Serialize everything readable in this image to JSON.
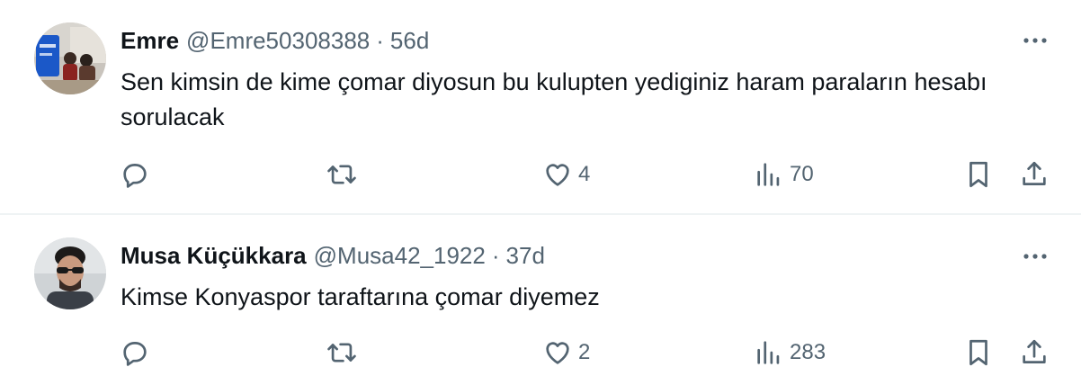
{
  "tweets": [
    {
      "name": "Emre",
      "handle": "@Emre50308388",
      "separator": "·",
      "time": "56d",
      "text": "Sen kimsin de kime çomar diyosun bu kulupten yediginiz haram paraların hesabı sorulacak",
      "likes": "4",
      "views": "70",
      "avatar_icon": "avatar-photo"
    },
    {
      "name": "Musa Küçükkara",
      "handle": "@Musa42_1922",
      "separator": "·",
      "time": "37d",
      "text": "Kimse Konyaspor taraftarına çomar diyemez",
      "likes": "2",
      "views": "283",
      "avatar_icon": "avatar-photo"
    }
  ],
  "icons": {
    "reply": "reply-icon",
    "retweet": "retweet-icon",
    "like": "heart-icon",
    "views": "views-icon",
    "bookmark": "bookmark-icon",
    "share": "share-icon",
    "more": "more-icon"
  },
  "colors": {
    "text": "#0f1419",
    "secondary": "#536471",
    "divider": "#eff3f4"
  }
}
